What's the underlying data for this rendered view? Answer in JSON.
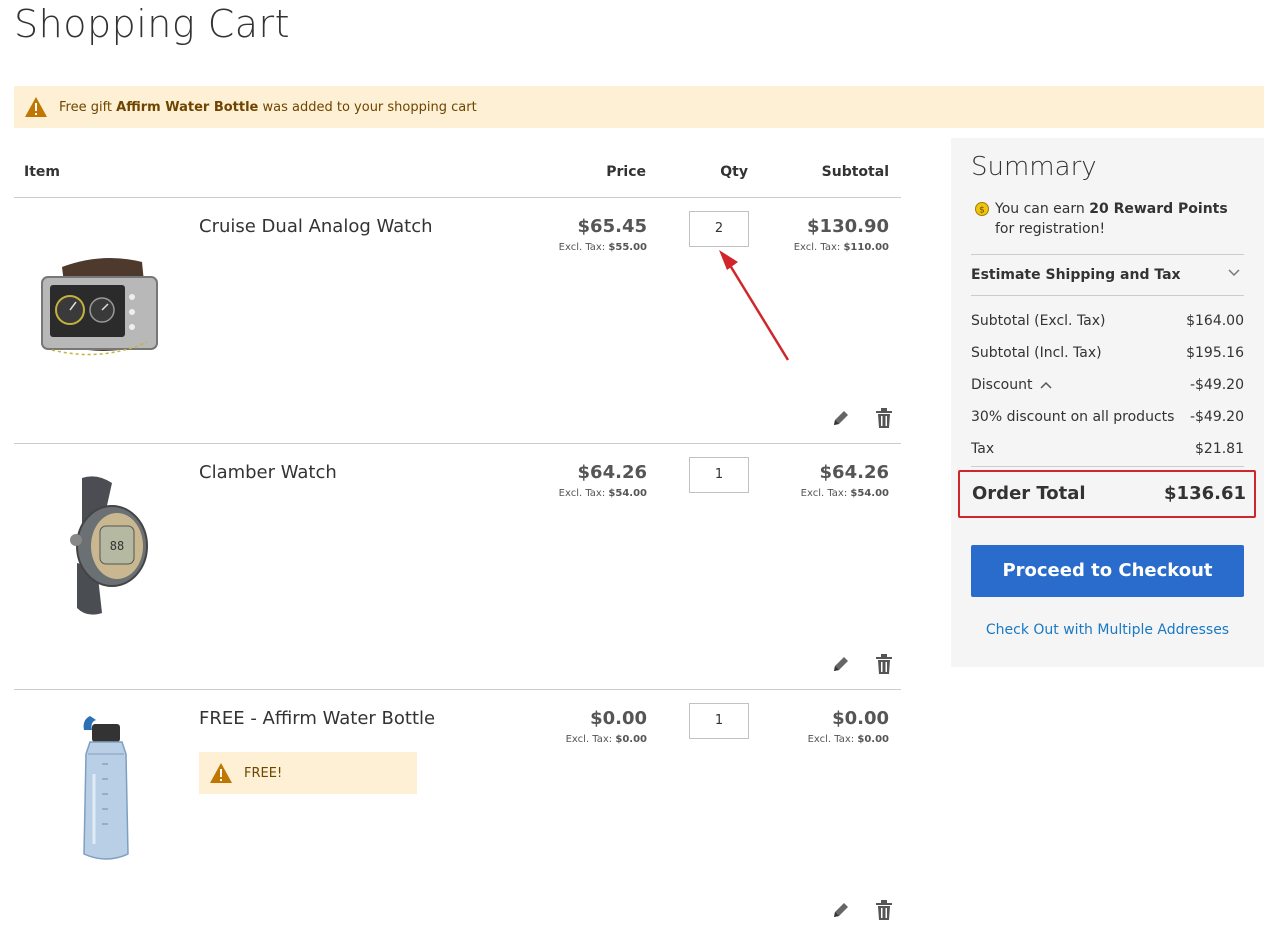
{
  "page": {
    "title": "Shopping Cart"
  },
  "notice": {
    "prefix": "Free gift ",
    "item": "Affirm Water Bottle",
    "suffix": " was added to your shopping cart"
  },
  "table": {
    "headers": {
      "item": "Item",
      "price": "Price",
      "qty": "Qty",
      "subtotal": "Subtotal"
    },
    "rows": [
      {
        "name": "Cruise Dual Analog Watch",
        "price": "$65.45",
        "price_excl_label": "Excl. Tax: ",
        "price_excl": "$55.00",
        "qty": "2",
        "subtotal": "$130.90",
        "subtotal_excl_label": "Excl. Tax: ",
        "subtotal_excl": "$110.00",
        "image_icon": "watch-analog-brown"
      },
      {
        "name": "Clamber Watch",
        "price": "$64.26",
        "price_excl_label": "Excl. Tax: ",
        "price_excl": "$54.00",
        "qty": "1",
        "subtotal": "$64.26",
        "subtotal_excl_label": "Excl. Tax: ",
        "subtotal_excl": "$54.00",
        "image_icon": "watch-digital-gray"
      },
      {
        "name": "FREE - Affirm Water Bottle",
        "price": "$0.00",
        "price_excl_label": "Excl. Tax: ",
        "price_excl": "$0.00",
        "qty": "1",
        "subtotal": "$0.00",
        "subtotal_excl_label": "Excl. Tax: ",
        "subtotal_excl": "$0.00",
        "image_icon": "water-bottle-blue",
        "badge": "FREE!"
      }
    ]
  },
  "summary": {
    "title": "Summary",
    "reward_prefix": "You can earn ",
    "reward_points": "20 Reward Points",
    "reward_suffix": " for registration!",
    "estimate_label": "Estimate Shipping and Tax",
    "totals": [
      {
        "label": "Subtotal (Excl. Tax)",
        "value": "$164.00"
      },
      {
        "label": "Subtotal (Incl. Tax)",
        "value": "$195.16"
      },
      {
        "label": "Discount",
        "value": "-$49.20"
      },
      {
        "label": "30% discount on all products",
        "value": "-$49.20"
      },
      {
        "label": "Tax",
        "value": "$21.81"
      }
    ],
    "order_total_label": "Order Total",
    "order_total_value": "$136.61",
    "checkout_label": "Proceed to Checkout",
    "multi_label": "Check Out with Multiple Addresses"
  },
  "colors": {
    "accent": "#2a6ccb",
    "notice_bg": "#fdf0d5",
    "highlight": "#d0262b",
    "link": "#1979c3"
  }
}
